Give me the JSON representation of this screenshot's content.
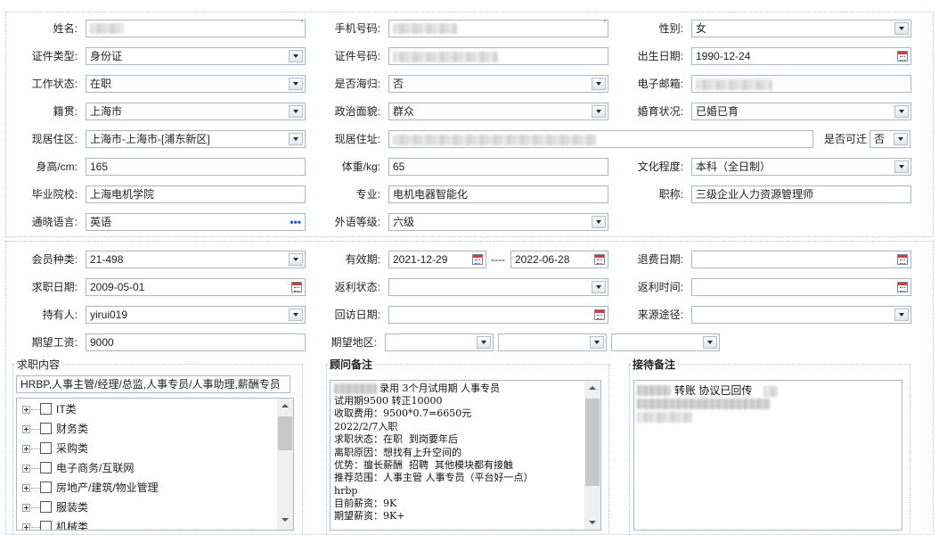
{
  "personal": {
    "name": {
      "label": "姓名:"
    },
    "mobile": {
      "label": "手机号码:"
    },
    "gender": {
      "label": "性别:",
      "value": "女"
    },
    "id_type": {
      "label": "证件类型:",
      "value": "身份证"
    },
    "id_number": {
      "label": "证件号码:"
    },
    "birth_date": {
      "label": "出生日期:",
      "value": "1990-12-24"
    },
    "work_status": {
      "label": "工作状态:",
      "value": "在职"
    },
    "returnee": {
      "label": "是否海归:",
      "value": "否"
    },
    "email": {
      "label": "电子邮箱:"
    },
    "native_place": {
      "label": "籍贯:",
      "value": "上海市"
    },
    "political": {
      "label": "政治面貌:",
      "value": "群众"
    },
    "marital": {
      "label": "婚育状况:",
      "value": "已婚已育"
    },
    "residence_area": {
      "label": "现居住区:",
      "value": "上海市-上海市-[浦东新区]"
    },
    "address": {
      "label": "现居住址:"
    },
    "relocate": {
      "label": "是否可迁",
      "value": "否"
    },
    "height": {
      "label": "身高/cm:",
      "value": "165"
    },
    "weight": {
      "label": "体重/kg:",
      "value": "65"
    },
    "education": {
      "label": "文化程度:",
      "value": "本科（全日制）"
    },
    "school": {
      "label": "毕业院校:",
      "value": "上海电机学院"
    },
    "major": {
      "label": "专业:",
      "value": "电机电器智能化"
    },
    "title": {
      "label": "职称:",
      "value": "三级企业人力资源管理师"
    },
    "language": {
      "label": "通晓语言:",
      "value": "英语",
      "more": "•••"
    },
    "foreign_level": {
      "label": "外语等级:",
      "value": "六级"
    }
  },
  "membership": {
    "member_type": {
      "label": "会员种类:",
      "value": "21-498"
    },
    "validity": {
      "label": "有效期:",
      "from": "2021-12-29",
      "sep": "----",
      "to": "2022-06-28"
    },
    "refund_date": {
      "label": "退费日期:",
      "value": ""
    },
    "job_date": {
      "label": "求职日期:",
      "value": "2009-05-01"
    },
    "rebate_status": {
      "label": "返利状态:",
      "value": ""
    },
    "rebate_time": {
      "label": "返利时间:",
      "value": ""
    },
    "holder": {
      "label": "持有人:",
      "value": "yirui019"
    },
    "revisit_date": {
      "label": "回访日期:",
      "value": ""
    },
    "source": {
      "label": "来源途径:",
      "value": ""
    },
    "expected_salary": {
      "label": "期望工资:",
      "value": "9000"
    },
    "expected_area": {
      "label": "期望地区:",
      "values": [
        "",
        "",
        ""
      ]
    }
  },
  "job_content": {
    "title": "求职内容",
    "value": "HRBP,人事主管/经理/总监,人事专员/人事助理,薪酬专员",
    "tree": [
      "IT类",
      "财务类",
      "采购类",
      "电子商务/互联网",
      "房地产/建筑/物业管理",
      "服装类",
      "机械类"
    ]
  },
  "advisor_notes": {
    "title": "顾问备注",
    "lines": [
      "录用 3个月试用期 人事专员",
      "试用期9500 转正10000",
      "收取费用：9500*0.7=6650元",
      "2022/2/7入职",
      "求职状态：在职  到岗要年后",
      "离职原因：想找有上升空间的",
      "优势：擅长薪酬  招聘  其他模块都有接触",
      "推荐范围：人事主管 人事专员（平台好一点）",
      "hrbp",
      "目前薪资：9K",
      "期望薪资：9K+"
    ]
  },
  "reception_notes": {
    "title": "接待备注",
    "text": "转账 协议已回传"
  },
  "colors": {
    "required": "#e02020",
    "border": "#a9b7c8",
    "accent": "#2f5db5"
  }
}
